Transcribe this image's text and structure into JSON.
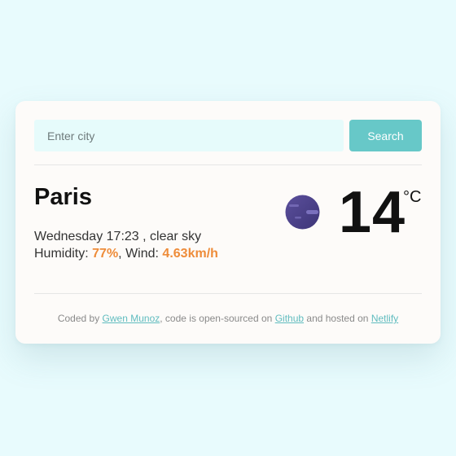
{
  "search": {
    "placeholder": "Enter city",
    "button_label": "Search"
  },
  "weather": {
    "city": "Paris",
    "datetime": "Wednesday 17:23",
    "condition": "clear sky",
    "humidity_label": "Humidity:",
    "humidity_value": "77%",
    "wind_label": "Wind:",
    "wind_value": "4.63km/h",
    "temperature": "14",
    "unit": "°C",
    "icon": "night-moon-icon"
  },
  "footer": {
    "coded_by": "Coded by",
    "author": "Gwen Munoz",
    "mid_text": ", code is open-sourced on",
    "github": "Github",
    "hosted_text": "and hosted on",
    "netlify": "Netlify"
  },
  "colors": {
    "accent": "#ee8c3a",
    "button": "#67c8c8",
    "link": "#5fbcbf",
    "background": "#e8fbfd"
  }
}
